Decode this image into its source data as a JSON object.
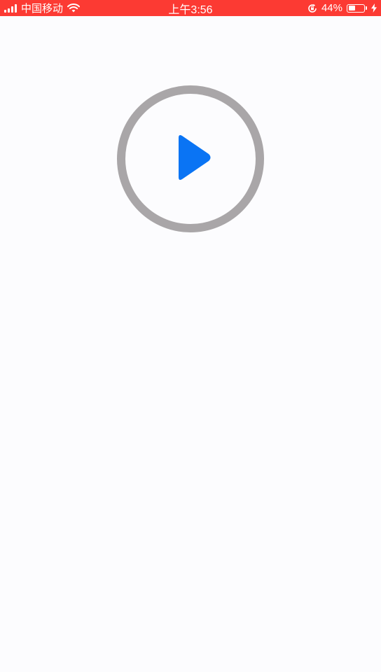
{
  "status_bar": {
    "carrier": "中国移动",
    "time": "上午3:56",
    "battery_percent_text": "44%",
    "battery_level": 0.44,
    "background_color": "#fc3a33",
    "icons": [
      "signal-bars-icon",
      "wifi-icon",
      "orientation-lock-icon",
      "battery-icon",
      "charging-bolt-icon"
    ]
  },
  "player": {
    "icon": "play-icon",
    "ring_color": "#a9a6a8",
    "play_color": "#0a74f4"
  }
}
